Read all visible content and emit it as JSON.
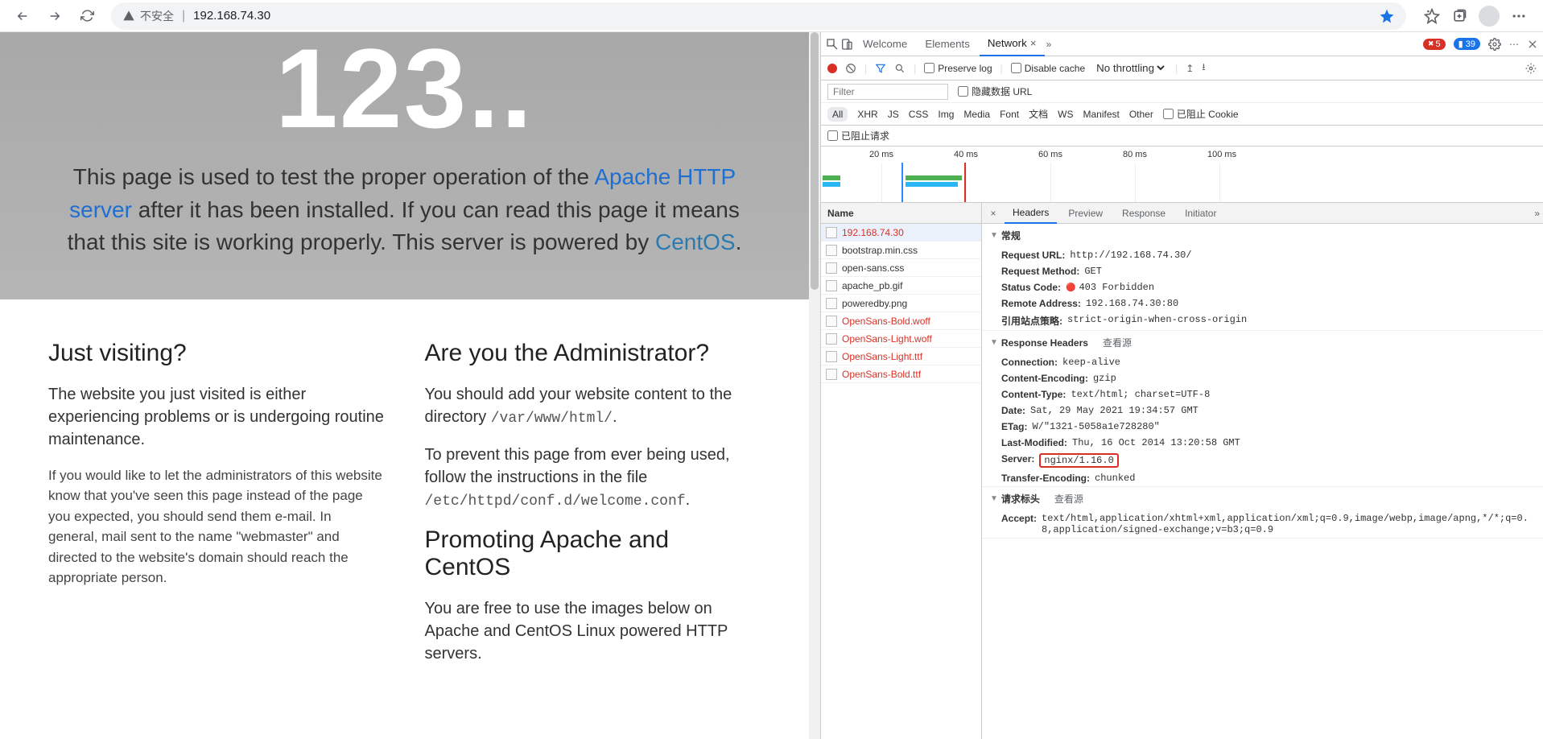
{
  "browser": {
    "security_label": "不安全",
    "url": "192.168.74.30"
  },
  "page": {
    "hero_number": "123..",
    "hero_text1": "This page is used to test the proper operation of the ",
    "hero_link1": "Apache HTTP server",
    "hero_text2": " after it has been installed. If you can read this page it means that this site is working properly. This server is powered by ",
    "hero_link2": "CentOS",
    "hero_text3": ".",
    "visiting_h": "Just visiting?",
    "visiting_p1": "The website you just visited is either experiencing problems or is undergoing routine maintenance.",
    "visiting_p2": "If you would like to let the administrators of this website know that you've seen this page instead of the page you expected, you should send them e-mail. In general, mail sent to the name \"webmaster\" and directed to the website's domain should reach the appropriate person.",
    "admin_h": "Are you the Administrator?",
    "admin_p1a": "You should add your website content to the directory ",
    "admin_p1b": "/var/www/html/",
    "admin_p1c": ".",
    "admin_p2a": "To prevent this page from ever being used, follow the instructions in the file ",
    "admin_p2b": "/etc/httpd/conf.d/welcome.conf",
    "admin_p2c": ".",
    "promote_h": "Promoting Apache and CentOS",
    "promote_p": "You are free to use the images below on Apache and CentOS Linux powered HTTP servers."
  },
  "devtools": {
    "tabs": {
      "welcome": "Welcome",
      "elements": "Elements",
      "network": "Network"
    },
    "err_count": "5",
    "info_count": "39",
    "toolbar": {
      "preserve": "Preserve log",
      "disable_cache": "Disable cache",
      "throttling": "No throttling"
    },
    "filter_placeholder": "Filter",
    "hide_data_url": "隐藏数据 URL",
    "types": [
      "All",
      "XHR",
      "JS",
      "CSS",
      "Img",
      "Media",
      "Font",
      "文档",
      "WS",
      "Manifest",
      "Other"
    ],
    "blocked_cookie": "已阻止 Cookie",
    "blocked_req": "已阻止请求",
    "wf_ticks": [
      "20 ms",
      "40 ms",
      "60 ms",
      "80 ms",
      "100 ms"
    ],
    "name_hdr": "Name",
    "requests": [
      {
        "name": "192.168.74.30",
        "cls": "red sel"
      },
      {
        "name": "bootstrap.min.css",
        "cls": "norm"
      },
      {
        "name": "open-sans.css",
        "cls": "norm"
      },
      {
        "name": "apache_pb.gif",
        "cls": "norm"
      },
      {
        "name": "poweredby.png",
        "cls": "norm"
      },
      {
        "name": "OpenSans-Bold.woff",
        "cls": "red"
      },
      {
        "name": "OpenSans-Light.woff",
        "cls": "red"
      },
      {
        "name": "OpenSans-Light.ttf",
        "cls": "red"
      },
      {
        "name": "OpenSans-Bold.ttf",
        "cls": "red"
      }
    ],
    "detail_tabs": {
      "headers": "Headers",
      "preview": "Preview",
      "response": "Response",
      "initiator": "Initiator"
    },
    "sections": {
      "general": "常规",
      "response_headers": "Response Headers",
      "request_headers": "请求标头",
      "view_source": "查看源"
    },
    "general": {
      "request_url_k": "Request URL:",
      "request_url_v": "http://192.168.74.30/",
      "request_method_k": "Request Method:",
      "request_method_v": "GET",
      "status_code_k": "Status Code:",
      "status_code_v": "403 Forbidden",
      "remote_addr_k": "Remote Address:",
      "remote_addr_v": "192.168.74.30:80",
      "referrer_k": "引用站点策略:",
      "referrer_v": "strict-origin-when-cross-origin"
    },
    "resp": {
      "connection_k": "Connection:",
      "connection_v": "keep-alive",
      "cenc_k": "Content-Encoding:",
      "cenc_v": "gzip",
      "ctype_k": "Content-Type:",
      "ctype_v": "text/html; charset=UTF-8",
      "date_k": "Date:",
      "date_v": "Sat, 29 May 2021 19:34:57 GMT",
      "etag_k": "ETag:",
      "etag_v": "W/\"1321-5058a1e728280\"",
      "lastmod_k": "Last-Modified:",
      "lastmod_v": "Thu, 16 Oct 2014 13:20:58 GMT",
      "server_k": "Server:",
      "server_v": "nginx/1.16.0",
      "tenc_k": "Transfer-Encoding:",
      "tenc_v": "chunked"
    },
    "req": {
      "accept_k": "Accept:",
      "accept_v": "text/html,application/xhtml+xml,application/xml;q=0.9,image/webp,image/apng,*/*;q=0.8,application/signed-exchange;v=b3;q=0.9"
    }
  }
}
